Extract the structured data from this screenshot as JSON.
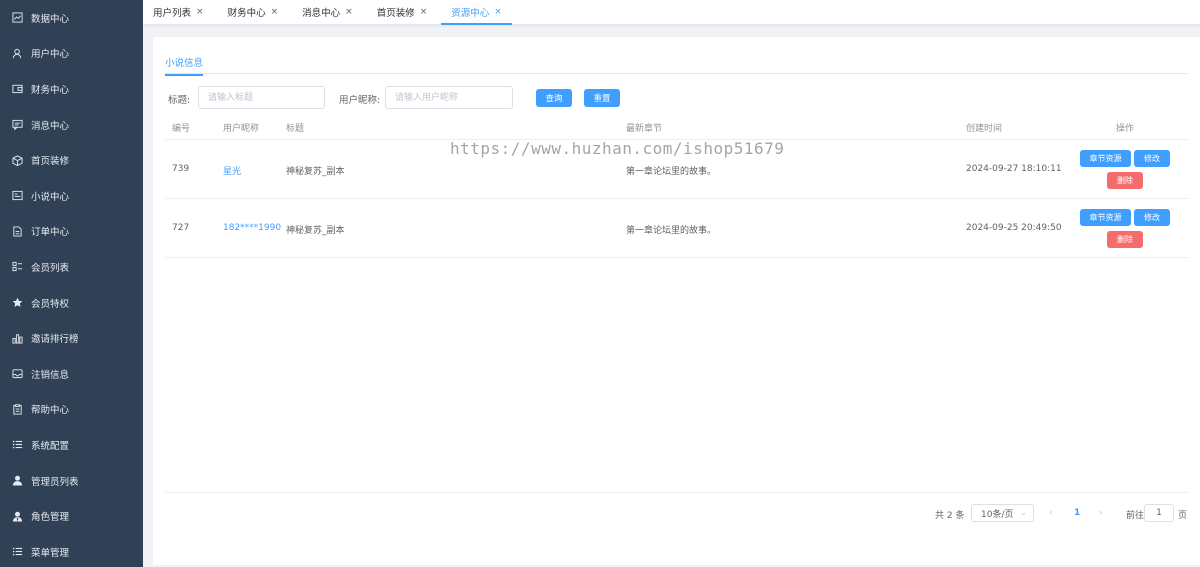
{
  "sidebar": {
    "items": [
      {
        "label": "数据中心",
        "icon": "chart-icon"
      },
      {
        "label": "用户中心",
        "icon": "user-icon"
      },
      {
        "label": "财务中心",
        "icon": "wallet-icon"
      },
      {
        "label": "消息中心",
        "icon": "message-icon"
      },
      {
        "label": "首页装修",
        "icon": "box-icon"
      },
      {
        "label": "小说中心",
        "icon": "book-icon"
      },
      {
        "label": "订单中心",
        "icon": "document-icon"
      },
      {
        "label": "会员列表",
        "icon": "grid-list-icon"
      },
      {
        "label": "会员特权",
        "icon": "star-icon"
      },
      {
        "label": "邀请排行榜",
        "icon": "bar-chart-icon"
      },
      {
        "label": "注销信息",
        "icon": "inbox-icon"
      },
      {
        "label": "帮助中心",
        "icon": "clipboard-icon"
      },
      {
        "label": "系统配置",
        "icon": "list-icon"
      },
      {
        "label": "管理员列表",
        "icon": "person-icon"
      },
      {
        "label": "角色管理",
        "icon": "person-tie-icon"
      },
      {
        "label": "菜单管理",
        "icon": "menu-list-icon"
      }
    ]
  },
  "tabs": [
    {
      "label": "用户列表",
      "active": false
    },
    {
      "label": "财务中心",
      "active": false
    },
    {
      "label": "消息中心",
      "active": false
    },
    {
      "label": "首页装修",
      "active": false
    },
    {
      "label": "资源中心",
      "active": true
    }
  ],
  "tab_close": "×",
  "subtab": "小说信息",
  "filter": {
    "title_label": "标题:",
    "title_placeholder": "请输入标题",
    "nickname_label": "用户昵称:",
    "nickname_placeholder": "请输入用户昵称",
    "query_button": "查询",
    "reset_button": "重置"
  },
  "table": {
    "headers": [
      "编号",
      "用户昵称",
      "标题",
      "最新章节",
      "创建时间",
      "操作"
    ],
    "rows": [
      {
        "id": "739",
        "nickname": "星光",
        "title": "神秘复苏_副本",
        "latest_chapter": "第一章论坛里的故事。",
        "created": "2024-09-27 18:10:11"
      },
      {
        "id": "727",
        "nickname": "182****1990",
        "title": "神秘复苏_副本",
        "latest_chapter": "第一章论坛里的故事。",
        "created": "2024-09-25 20:49:50"
      }
    ],
    "actions": {
      "resource": "章节资源",
      "edit": "修改",
      "delete": "删除"
    }
  },
  "pagination": {
    "total": "共 2 条",
    "page_size": "10条/页",
    "current_page": "1",
    "goto_label": "前往",
    "goto_value": "1",
    "page_unit": "页"
  },
  "watermark": "https://www.huzhan.com/ishop51679",
  "colors": {
    "sidebar_bg": "#304156",
    "accent": "#409eff",
    "danger": "#f56c6c"
  }
}
